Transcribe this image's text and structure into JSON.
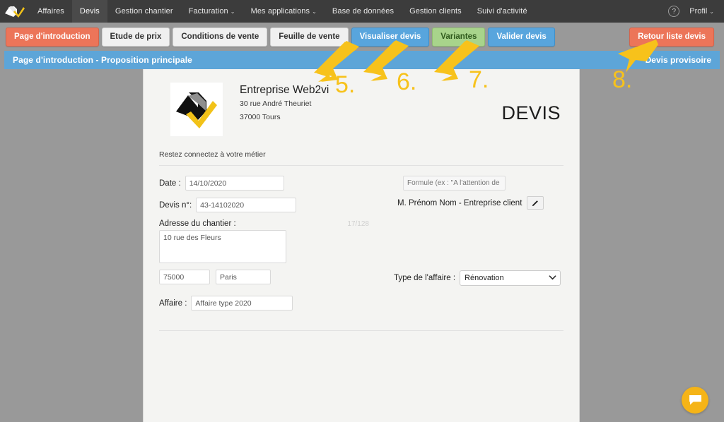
{
  "topnav": {
    "logo_alt": "web2vi-logo",
    "items": [
      {
        "label": "Affaires",
        "active": false,
        "caret": false
      },
      {
        "label": "Devis",
        "active": true,
        "caret": false
      },
      {
        "label": "Gestion chantier",
        "active": false,
        "caret": false
      },
      {
        "label": "Facturation",
        "active": false,
        "caret": true
      },
      {
        "label": "Mes applications",
        "active": false,
        "caret": true
      },
      {
        "label": "Base de données",
        "active": false,
        "caret": false
      },
      {
        "label": "Gestion clients",
        "active": false,
        "caret": false
      },
      {
        "label": "Suivi d'activité",
        "active": false,
        "caret": false
      }
    ],
    "help_glyph": "?",
    "profile_label": "Profil",
    "profile_caret": "⌄"
  },
  "tabs": [
    {
      "label": "Page d'introduction",
      "style": "tab-orange"
    },
    {
      "label": "Etude de prix",
      "style": "tab-grey"
    },
    {
      "label": "Conditions de vente",
      "style": "tab-grey"
    },
    {
      "label": "Feuille de vente",
      "style": "tab-grey"
    },
    {
      "label": "Visualiser devis",
      "style": "tab-blue"
    },
    {
      "label": "Variantes",
      "style": "tab-green"
    },
    {
      "label": "Valider devis",
      "style": "tab-blue"
    }
  ],
  "return_button": {
    "label": "Retour liste devis"
  },
  "titlebar": {
    "left": "Page d'introduction - Proposition principale",
    "right": "Devis provisoire"
  },
  "document": {
    "company_name": "Entreprise Web2vi",
    "company_street": "30 rue André Theuriet",
    "company_city": "37000 Tours",
    "doc_title": "DEVIS",
    "tagline": "Restez connectez à votre métier",
    "fields": {
      "date_label": "Date :",
      "date_value": "14/10/2020",
      "devis_label": "Devis n°:",
      "devis_value": "43-14102020",
      "address_label": "Adresse du chantier :",
      "address_counter": "17/128",
      "address_value": "10 rue des Fleurs",
      "postal_value": "75000",
      "city_value": "Paris",
      "affaire_label": "Affaire :",
      "affaire_value": "Affaire type 2020",
      "formule_placeholder": "Formule (ex : \"A l'attention de :\")",
      "formule_value": "",
      "client_name": "M. Prénom Nom - Entreprise client",
      "edit_icon": "pencil-icon",
      "type_label": "Type de l'affaire :",
      "type_value": "Rénovation",
      "type_options": [
        "Rénovation"
      ]
    }
  },
  "annotations": [
    {
      "number": "5."
    },
    {
      "number": "6."
    },
    {
      "number": "7."
    },
    {
      "number": "8."
    }
  ],
  "chat": {
    "icon": "chat-bubble-icon"
  },
  "colors": {
    "nav_bg": "#3c3c3c",
    "page_bg": "#999999",
    "accent_orange": "#ec7559",
    "accent_blue": "#58a5dd",
    "accent_green": "#a8d48b",
    "titlebar_blue": "#5da5d8",
    "annotation_yellow": "#f7c21b",
    "chat_yellow": "#f5b417"
  }
}
